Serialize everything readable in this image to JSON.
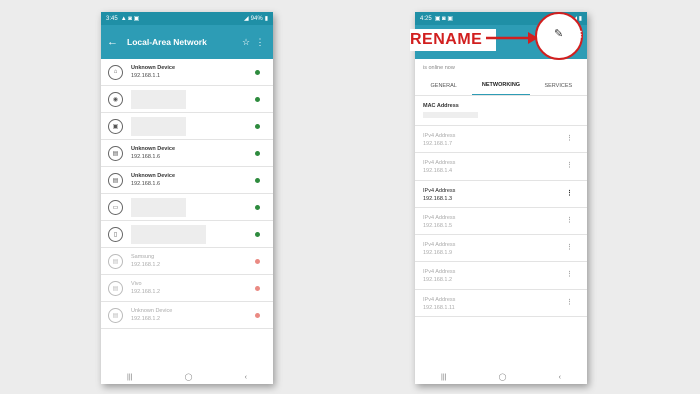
{
  "left": {
    "status": {
      "time": "3:45",
      "battery": "94%"
    },
    "title": "Local-Area Network",
    "devices": [
      {
        "name": "Unknown Device",
        "ip": "192.168.1.1",
        "online": true,
        "icon": "router-icon",
        "glyph": "⌂",
        "redacted": false,
        "faded": false
      },
      {
        "name": "",
        "ip": "",
        "online": true,
        "icon": "gamepad-icon",
        "glyph": "◉",
        "redacted": true,
        "faded": false
      },
      {
        "name": "",
        "ip": "",
        "online": true,
        "icon": "device-icon",
        "glyph": "▣",
        "redacted": true,
        "faded": false
      },
      {
        "name": "Unknown Device",
        "ip": "192.168.1.6",
        "online": true,
        "icon": "device-icon",
        "glyph": "▤",
        "redacted": false,
        "faded": false
      },
      {
        "name": "Unknown Device",
        "ip": "192.168.1.6",
        "online": true,
        "icon": "device-icon",
        "glyph": "▤",
        "redacted": false,
        "faded": false
      },
      {
        "name": "",
        "ip": "",
        "online": true,
        "icon": "laptop-icon",
        "glyph": "▭",
        "redacted": true,
        "faded": false
      },
      {
        "name": "",
        "ip": "",
        "online": true,
        "icon": "phone-icon",
        "glyph": "▯",
        "redacted": true,
        "faded": false
      },
      {
        "name": "Samsung",
        "ip": "192.168.1.2",
        "online": false,
        "icon": "device-icon",
        "glyph": "▤",
        "redacted": false,
        "faded": true
      },
      {
        "name": "Vivo",
        "ip": "192.168.1.2",
        "online": false,
        "icon": "device-icon",
        "glyph": "▤",
        "redacted": false,
        "faded": true
      },
      {
        "name": "Unknown Device",
        "ip": "192.168.1.2",
        "online": false,
        "icon": "device-icon",
        "glyph": "▤",
        "redacted": false,
        "faded": true
      }
    ]
  },
  "right": {
    "status": {
      "time": "4:25"
    },
    "online_text": "is online now",
    "tabs": [
      "GENERAL",
      "NETWORKING",
      "SERVICES"
    ],
    "active_tab": 1,
    "mac_label": "MAC Address",
    "addresses": [
      {
        "label": "IPv4 Address",
        "value": "192.168.1.7",
        "highlight": false
      },
      {
        "label": "IPv4 Address",
        "value": "192.168.1.4",
        "highlight": false
      },
      {
        "label": "IPv4 Address",
        "value": "192.168.1.3",
        "highlight": true
      },
      {
        "label": "IPv4 Address",
        "value": "192.168.1.5",
        "highlight": false
      },
      {
        "label": "IPv4 Address",
        "value": "192.168.1.9",
        "highlight": false
      },
      {
        "label": "IPv4 Address",
        "value": "192.168.1.2",
        "highlight": false
      },
      {
        "label": "IPv4 Address",
        "value": "192.168.1.11",
        "highlight": false
      }
    ]
  },
  "annotation": {
    "label": "RENAME",
    "color": "#d11f1f"
  },
  "colors": {
    "accent": "#2d9cb5",
    "online": "#2e8b3e",
    "offline": "#ea8a83"
  }
}
